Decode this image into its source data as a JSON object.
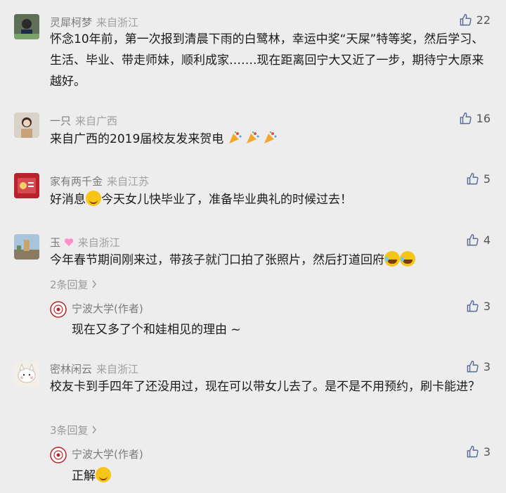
{
  "comments": [
    {
      "name": "灵犀柯梦",
      "location": "来自浙江",
      "likes": "22",
      "text": "怀念10年前，第一次报到清晨下雨的白鹭林，幸运中奖“天屎”特等奖，然后学习、生活、毕业、带走师妹，顺利成家…….现在距离回宁大又近了一步，期待宁大原来越好。"
    },
    {
      "name": "一只",
      "location": "来自广西",
      "likes": "16",
      "text": "来自广西的2019届校友发来贺电"
    },
    {
      "name": "家有两千金",
      "location": "来自江苏",
      "likes": "5",
      "text_before": "好消息",
      "text_after": "今天女儿快毕业了，准备毕业典礼的时候过去！"
    },
    {
      "name": "玉",
      "location": "来自浙江",
      "likes": "4",
      "text": "今年春节期间刚来过，带孩子就门口拍了张照片，然后打道回府",
      "more_replies": "2条回复",
      "reply": {
        "name": "宁波大学(作者)",
        "likes": "3",
        "text": "现在又多了个和娃相见的理由 ~"
      }
    },
    {
      "name": "密林闲云",
      "location": "来自浙江",
      "likes": "3",
      "text": "校友卡到手四年了还没用过，现在可以带女儿去了。是不是不用预约，刷卡能进？",
      "more_replies": "3条回复",
      "reply": {
        "name": "宁波大学(作者)",
        "likes": "3",
        "text": "正解"
      }
    }
  ],
  "icons": {
    "like": "thumbs-up-icon",
    "chevron": "chevron-right-icon"
  },
  "colors": {
    "background": "#ededed",
    "name": "#7b7b7b",
    "text": "#1a1a1a",
    "meta": "#9a9a9a"
  }
}
